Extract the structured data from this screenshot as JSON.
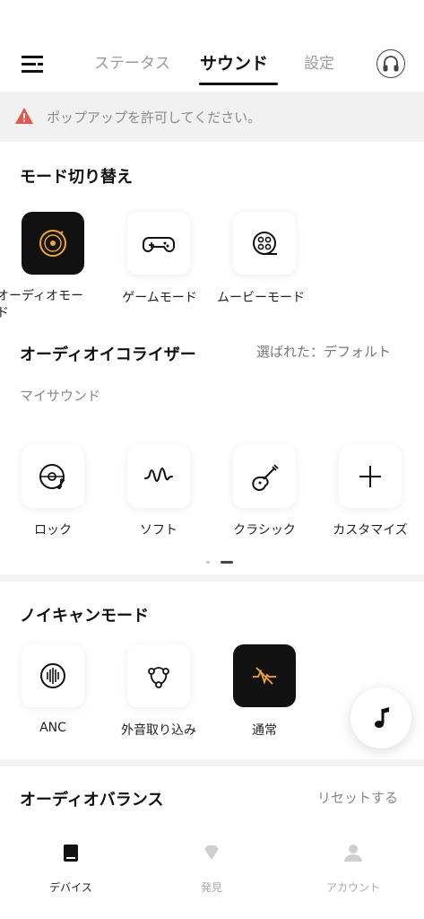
{
  "header": {
    "tabs": [
      {
        "label": "ステータス",
        "active": false
      },
      {
        "label": "サウンド",
        "active": true
      },
      {
        "label": "設定",
        "active": false
      }
    ],
    "menu_icon": "menu-icon",
    "profile_icon": "headphones-icon"
  },
  "alert": {
    "text": "ポップアップを許可してください。",
    "icon": "warning-icon",
    "icon_color": "#e05a4f"
  },
  "mode_section": {
    "title": "モード切り替え",
    "modes": [
      {
        "label": "オーディオモード",
        "icon": "vinyl-disc-icon",
        "selected": true
      },
      {
        "label": "ゲームモード",
        "icon": "gamepad-icon",
        "selected": false
      },
      {
        "label": "ムービーモード",
        "icon": "film-reel-icon",
        "selected": false
      }
    ]
  },
  "equalizer_section": {
    "title": "オーディオイコライザー",
    "selected_text": "選ばれた：デフォルト",
    "subheading": "マイサウンド",
    "presets": [
      {
        "label": "ロック",
        "icon": "rock-disc-icon"
      },
      {
        "label": "ソフト",
        "icon": "soft-wave-icon"
      },
      {
        "label": "クラシック",
        "icon": "guitar-icon"
      },
      {
        "label": "カスタマイズ",
        "icon": "plus-icon"
      }
    ],
    "page_indicator": {
      "pages": 2,
      "current": 2
    }
  },
  "noise_section": {
    "title": "ノイキャンモード",
    "modes": [
      {
        "label": "ANC",
        "icon": "anc-waveform-icon",
        "selected": false
      },
      {
        "label": "外音取り込み",
        "icon": "ambient-nodes-icon",
        "selected": false
      },
      {
        "label": "通常",
        "icon": "normal-off-icon",
        "selected": true
      }
    ]
  },
  "balance_section": {
    "title": "オーディオバランス",
    "reset_label": "リセットする"
  },
  "fab": {
    "icon": "music-note-icon"
  },
  "bottom_nav": [
    {
      "label": "デバイス",
      "icon": "device-icon",
      "active": true
    },
    {
      "label": "発見",
      "icon": "diamond-icon",
      "active": false
    },
    {
      "label": "アカウント",
      "icon": "person-icon",
      "active": false
    }
  ],
  "colors": {
    "accent": "#f5a623",
    "text_primary": "#111111",
    "text_muted": "#9a9a9a",
    "alert_bg": "#f1f1f1"
  }
}
